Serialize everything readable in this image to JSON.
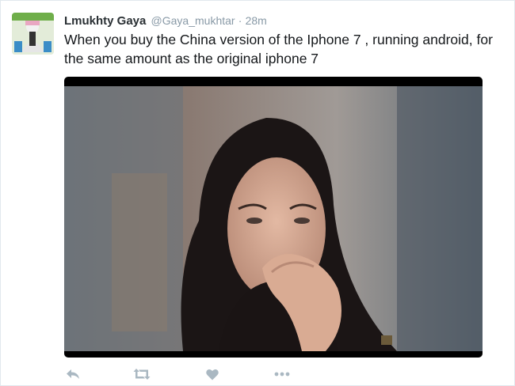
{
  "tweet": {
    "author_name": "Lmukhty Gaya",
    "author_handle": "@Gaya_mukhtar",
    "separator": "·",
    "time": "28m",
    "text": "When you buy the China version of the Iphone 7 , running android, for the same amount as the original iphone 7"
  },
  "actions": [
    {
      "name": "reply",
      "icon": "reply-icon"
    },
    {
      "name": "retweet",
      "icon": "retweet-icon"
    },
    {
      "name": "like",
      "icon": "heart-icon"
    },
    {
      "name": "more",
      "icon": "more-icon"
    }
  ],
  "colors": {
    "text": "#14171a",
    "name": "#292f33",
    "meta": "#8899a6",
    "icon": "#aab8c2",
    "border": "#e1e8ed"
  }
}
